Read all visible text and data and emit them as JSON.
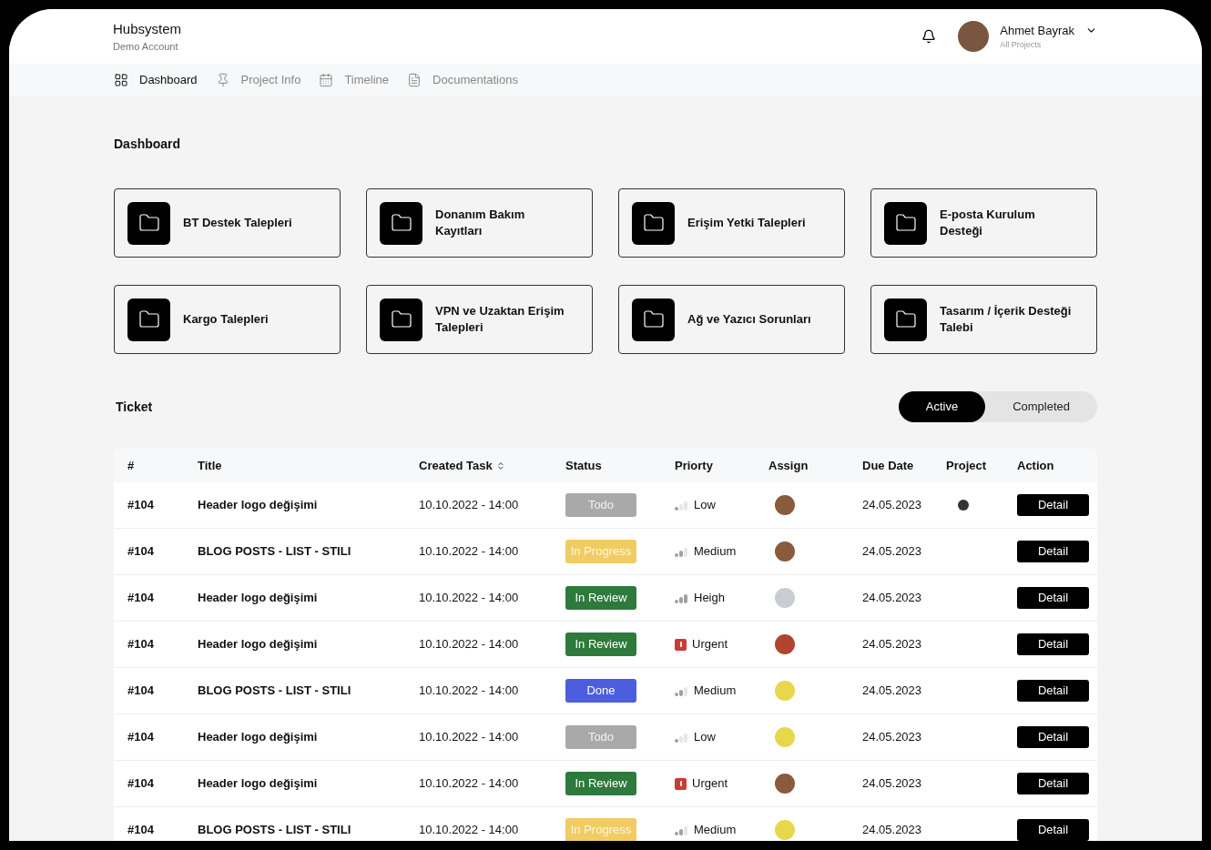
{
  "header": {
    "app_name": "Hubsystem",
    "account": "Demo Account",
    "user": {
      "name": "Ahmet Bayrak",
      "subtitle": "All Projects"
    }
  },
  "nav": [
    {
      "label": "Dashboard",
      "selected": true
    },
    {
      "label": "Project Info",
      "selected": false
    },
    {
      "label": "Timeline",
      "selected": false
    },
    {
      "label": "Documentations",
      "selected": false
    }
  ],
  "page_title": "Dashboard",
  "folders": [
    {
      "label": "BT Destek Talepleri"
    },
    {
      "label": "Donanım Bakım Kayıtları"
    },
    {
      "label": "Erişim Yetki Talepleri"
    },
    {
      "label": "E-posta Kurulum Desteği"
    },
    {
      "label": "Kargo Talepleri"
    },
    {
      "label": "VPN ve Uzaktan Erişim Talepleri"
    },
    {
      "label": "Ağ ve Yazıcı Sorunları"
    },
    {
      "label": "Tasarım / İçerik Desteği Talebi"
    }
  ],
  "ticket": {
    "title": "Ticket",
    "filters": [
      {
        "label": "Active",
        "selected": true
      },
      {
        "label": "Completed",
        "selected": false
      }
    ],
    "columns": [
      {
        "label": "#",
        "sortable": false
      },
      {
        "label": "Title",
        "sortable": false
      },
      {
        "label": "Created Task",
        "sortable": true
      },
      {
        "label": "Status",
        "sortable": false
      },
      {
        "label": "Priorty",
        "sortable": false
      },
      {
        "label": "Assign",
        "sortable": false
      },
      {
        "label": "Due Date",
        "sortable": false
      },
      {
        "label": "Project",
        "sortable": false
      },
      {
        "label": "Action",
        "sortable": false
      }
    ],
    "rows": [
      {
        "id": "#104",
        "title": "Header logo değişimi",
        "created": "10.10.2022 - 14:00",
        "status": {
          "label": "Todo",
          "kind": "todo"
        },
        "priority": {
          "label": "Low",
          "kind": "low"
        },
        "color": "#8a5a3c",
        "due": "24.05.2023",
        "project_icon": true,
        "action": "Detail"
      },
      {
        "id": "#104",
        "title": "BLOG POSTS - LIST - STILI",
        "created": "10.10.2022 - 14:00",
        "status": {
          "label": "In Progress",
          "kind": "in_progress"
        },
        "priority": {
          "label": "Medium",
          "kind": "medium"
        },
        "color": "#8a5a3c",
        "due": "24.05.2023",
        "project_icon": false,
        "action": "Detail"
      },
      {
        "id": "#104",
        "title": "Header logo değişimi",
        "created": "10.10.2022 - 14:00",
        "status": {
          "label": "In Review",
          "kind": "in_review"
        },
        "priority": {
          "label": "Heigh",
          "kind": "high"
        },
        "color": "#c9cdd2",
        "due": "24.05.2023",
        "project_icon": false,
        "action": "Detail"
      },
      {
        "id": "#104",
        "title": "Header logo değişimi",
        "created": "10.10.2022 - 14:00",
        "status": {
          "label": "In Review",
          "kind": "in_review"
        },
        "priority": {
          "label": "Urgent",
          "kind": "urgent"
        },
        "color": "#b0442c",
        "due": "24.05.2023",
        "project_icon": false,
        "action": "Detail"
      },
      {
        "id": "#104",
        "title": "BLOG POSTS - LIST - STILI",
        "created": "10.10.2022 - 14:00",
        "status": {
          "label": "Done",
          "kind": "done"
        },
        "priority": {
          "label": "Medium",
          "kind": "medium"
        },
        "color": "#e6d84a",
        "due": "24.05.2023",
        "project_icon": false,
        "action": "Detail"
      },
      {
        "id": "#104",
        "title": "Header logo değişimi",
        "created": "10.10.2022 - 14:00",
        "status": {
          "label": "Todo",
          "kind": "todo"
        },
        "priority": {
          "label": "Low",
          "kind": "low"
        },
        "color": "#e6d84a",
        "due": "24.05.2023",
        "project_icon": false,
        "action": "Detail"
      },
      {
        "id": "#104",
        "title": "Header logo değişimi",
        "created": "10.10.2022 - 14:00",
        "status": {
          "label": "In Review",
          "kind": "in_review"
        },
        "priority": {
          "label": "Urgent",
          "kind": "urgent"
        },
        "color": "#8a5a3c",
        "due": "24.05.2023",
        "project_icon": false,
        "action": "Detail"
      },
      {
        "id": "#104",
        "title": "BLOG POSTS - LIST - STILI",
        "created": "10.10.2022 - 14:00",
        "status": {
          "label": "In Progress",
          "kind": "in_progress"
        },
        "priority": {
          "label": "Medium",
          "kind": "medium"
        },
        "color": "#e6d84a",
        "due": "24.05.2023",
        "project_icon": false,
        "action": "Detail"
      }
    ]
  }
}
